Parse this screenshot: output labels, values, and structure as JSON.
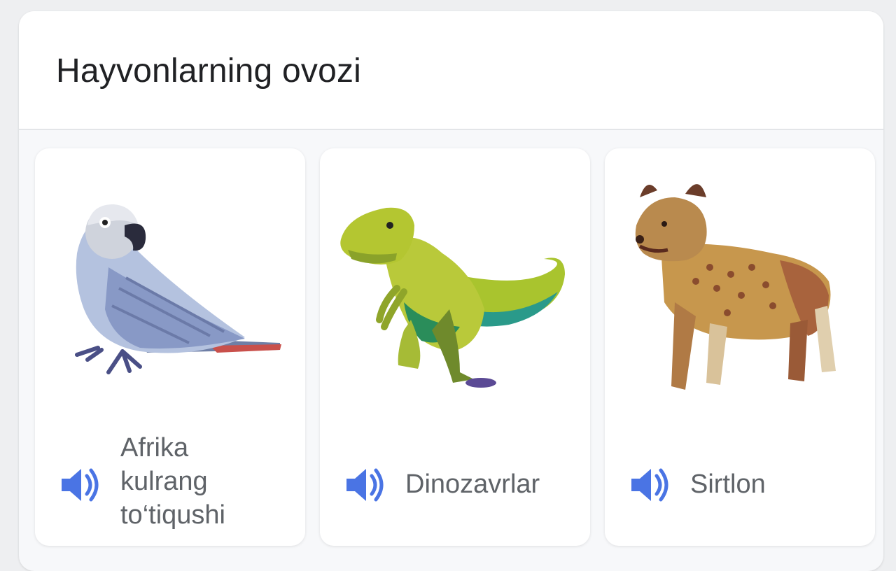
{
  "header": {
    "title": "Hayvonlarning ovozi"
  },
  "tiles": [
    {
      "name": "Afrika kulrang to‘tiqushi",
      "image": "parrot-illustration",
      "icon": "speaker-icon"
    },
    {
      "name": "Dinozavrlar",
      "image": "dinosaur-illustration",
      "icon": "speaker-icon"
    },
    {
      "name": "Sirtlon",
      "image": "hyena-illustration",
      "icon": "speaker-icon"
    }
  ],
  "colors": {
    "accent": "#4a74e4",
    "title": "#202124",
    "label": "#5f6368"
  }
}
